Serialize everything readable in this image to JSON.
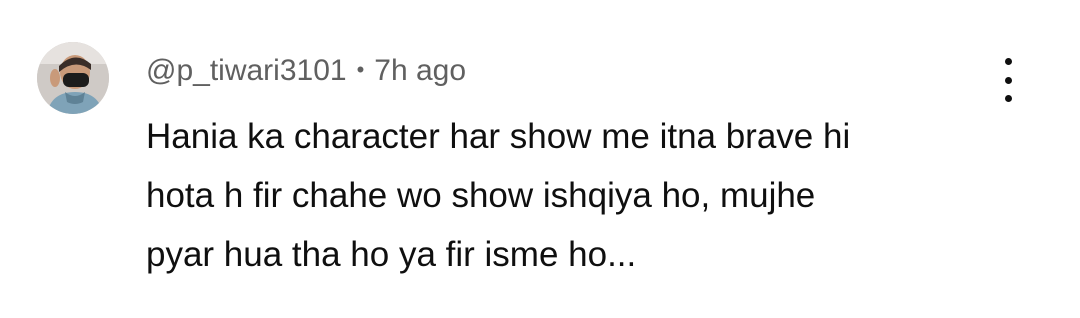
{
  "comment": {
    "author": "@p_tiwari3101",
    "separator": "•",
    "timestamp": "7h ago",
    "text_lines": [
      "Hania ka character har show me itna brave hi",
      "hota h fir chahe wo show ishqiya ho, mujhe",
      "pyar hua tha ho ya fir isme ho..."
    ],
    "avatar_icon": "user-avatar-photo",
    "menu_icon": "more-vert-icon"
  },
  "colors": {
    "meta_text": "#606060",
    "body_text": "#0f0f0f",
    "background": "#ffffff"
  }
}
